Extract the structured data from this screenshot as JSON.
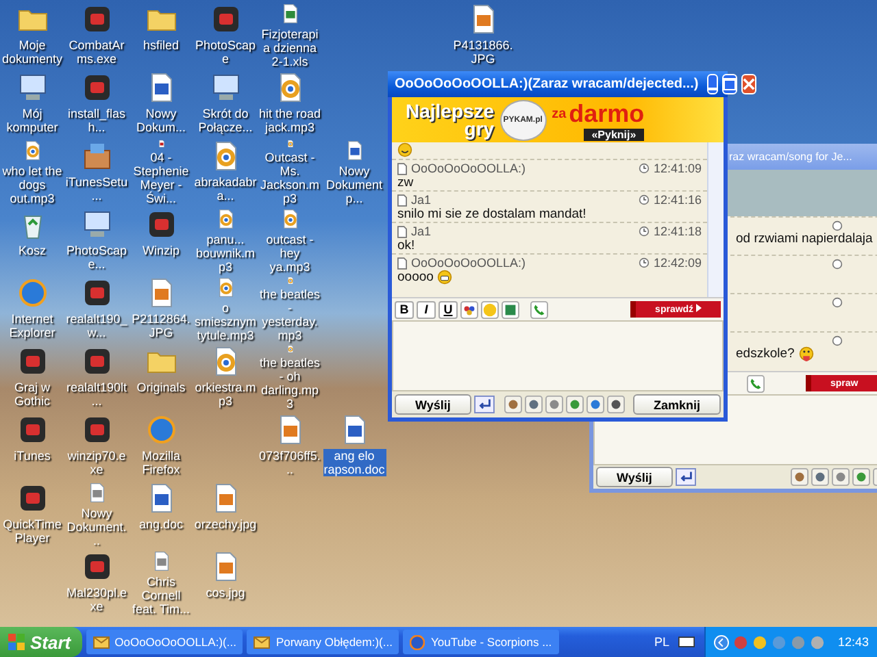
{
  "desktop": {
    "icons": [
      {
        "label": "Moje dokumenty",
        "kind": "folder",
        "selected": false
      },
      {
        "label": "Mój komputer",
        "kind": "computer",
        "selected": false
      },
      {
        "label": "who let the dogs out.mp3",
        "kind": "audio",
        "selected": false
      },
      {
        "label": "Kosz",
        "kind": "recycle",
        "selected": false
      },
      {
        "label": "Internet Explorer",
        "kind": "browser",
        "selected": false
      },
      {
        "label": "Graj w Gothic",
        "kind": "program",
        "selected": false
      },
      {
        "label": "iTunes",
        "kind": "program",
        "selected": false
      },
      {
        "label": "QuickTime Player",
        "kind": "program",
        "selected": false
      },
      {
        "label": "CombatArms.exe",
        "kind": "program",
        "selected": false
      },
      {
        "label": "install_flash...",
        "kind": "program",
        "selected": false
      },
      {
        "label": "iTunesSetu...",
        "kind": "installer",
        "selected": false
      },
      {
        "label": "PhotoScape...",
        "kind": "computer",
        "selected": false
      },
      {
        "label": "realalt190_w...",
        "kind": "program",
        "selected": false
      },
      {
        "label": "realalt190lt...",
        "kind": "program",
        "selected": false
      },
      {
        "label": "winzip70.exe",
        "kind": "program",
        "selected": false
      },
      {
        "label": "Nowy Dokument...",
        "kind": "document",
        "selected": false
      },
      {
        "label": "Mal230pl.exe",
        "kind": "program",
        "selected": false
      },
      {
        "label": "hsfiled",
        "kind": "folder",
        "selected": false
      },
      {
        "label": "Nowy Dokum...",
        "kind": "word",
        "selected": false
      },
      {
        "label": "04 - Stephenie Meyer - Świ...",
        "kind": "pdf",
        "selected": false
      },
      {
        "label": "Winzip",
        "kind": "program",
        "selected": false
      },
      {
        "label": "P2112864.JPG",
        "kind": "image",
        "selected": false
      },
      {
        "label": "Originals",
        "kind": "folder",
        "selected": false
      },
      {
        "label": "Mozilla Firefox",
        "kind": "browser",
        "selected": false
      },
      {
        "label": "ang.doc",
        "kind": "word",
        "selected": false
      },
      {
        "label": "Chris Cornell feat. Tim...",
        "kind": "document",
        "selected": false
      },
      {
        "label": "PhotoScape",
        "kind": "program",
        "selected": false
      },
      {
        "label": "Skrót do Połącze...",
        "kind": "computer",
        "selected": false
      },
      {
        "label": "abrakadabra...",
        "kind": "audio",
        "selected": false
      },
      {
        "label": "panu... bouwnik.mp3",
        "kind": "audio",
        "selected": false
      },
      {
        "label": "o smiesznym tytule.mp3",
        "kind": "audio",
        "selected": false
      },
      {
        "label": "orkiestra.mp3",
        "kind": "audio",
        "selected": false
      },
      {
        "label": "orzechy.jpg",
        "kind": "image",
        "selected": false
      },
      {
        "label": "cos.jpg",
        "kind": "image",
        "selected": false
      },
      {
        "label": "Fizjoterapia dzienna 2-1.xls",
        "kind": "excel",
        "selected": false
      },
      {
        "label": "hit the road jack.mp3",
        "kind": "audio",
        "selected": false
      },
      {
        "label": "Outcast - Ms. Jackson.mp3",
        "kind": "audio",
        "selected": false
      },
      {
        "label": "outcast - hey ya.mp3",
        "kind": "audio",
        "selected": false
      },
      {
        "label": "the beatles - yesterday.mp3",
        "kind": "audio",
        "selected": false
      },
      {
        "label": "the beatles - oh darling.mp3",
        "kind": "audio",
        "selected": false
      },
      {
        "label": "073f706ff5...",
        "kind": "image",
        "selected": false
      },
      {
        "label": "Nowy Dokument p...",
        "kind": "word",
        "selected": false
      },
      {
        "label": "ang elo rapson.doc",
        "kind": "word",
        "selected": true
      },
      {
        "label": "P4131866.JPG",
        "kind": "image",
        "selected": false
      }
    ]
  },
  "back_chat": {
    "title": "raz wracam/song for Je...",
    "messages": [
      {
        "text": "od rzwiami napierdalaja",
        "emoticon": false
      },
      {
        "emoticon": false
      },
      {
        "emoticon": false
      },
      {
        "text": "edszkole?",
        "emoticon": true
      }
    ],
    "ad_button": "spraw",
    "send_button": "Wyślij"
  },
  "front_chat": {
    "title": "OoOoOoOoOOLLA:)(Zaraz wracam/dejected...)",
    "banner": {
      "line1": "Najlepsze",
      "line2": "gry",
      "logo": "PYKAM.pl",
      "line3": "za",
      "line4": "darmo",
      "link": "«Pyknij»"
    },
    "messages": [
      {
        "author": "OoOoOoOoOOLLA:)",
        "time": "12:41:09",
        "text": "zw",
        "emoticon": false
      },
      {
        "author": "Ja1",
        "time": "12:41:16",
        "text": "snilo mi sie ze dostalam mandat!",
        "emoticon": false
      },
      {
        "author": "Ja1",
        "time": "12:41:18",
        "text": "ok!",
        "emoticon": false
      },
      {
        "author": "OoOoOoOoOOLLA:)",
        "time": "12:42:09",
        "text": "ooooo",
        "emoticon": true
      }
    ],
    "format_buttons": [
      "B",
      "I",
      "U"
    ],
    "ad_button": "sprawdź",
    "send_button": "Wyślij",
    "close_button": "Zamknij"
  },
  "taskbar": {
    "start": "Start",
    "tasks": [
      {
        "label": "OoOoOoOoOOLLA:)(...",
        "kind": "chat"
      },
      {
        "label": "Porwany Obłędem:)(...",
        "kind": "chat"
      },
      {
        "label": "YouTube - Scorpions ...",
        "kind": "browser"
      }
    ],
    "language": "PL",
    "clock": "12:43"
  }
}
